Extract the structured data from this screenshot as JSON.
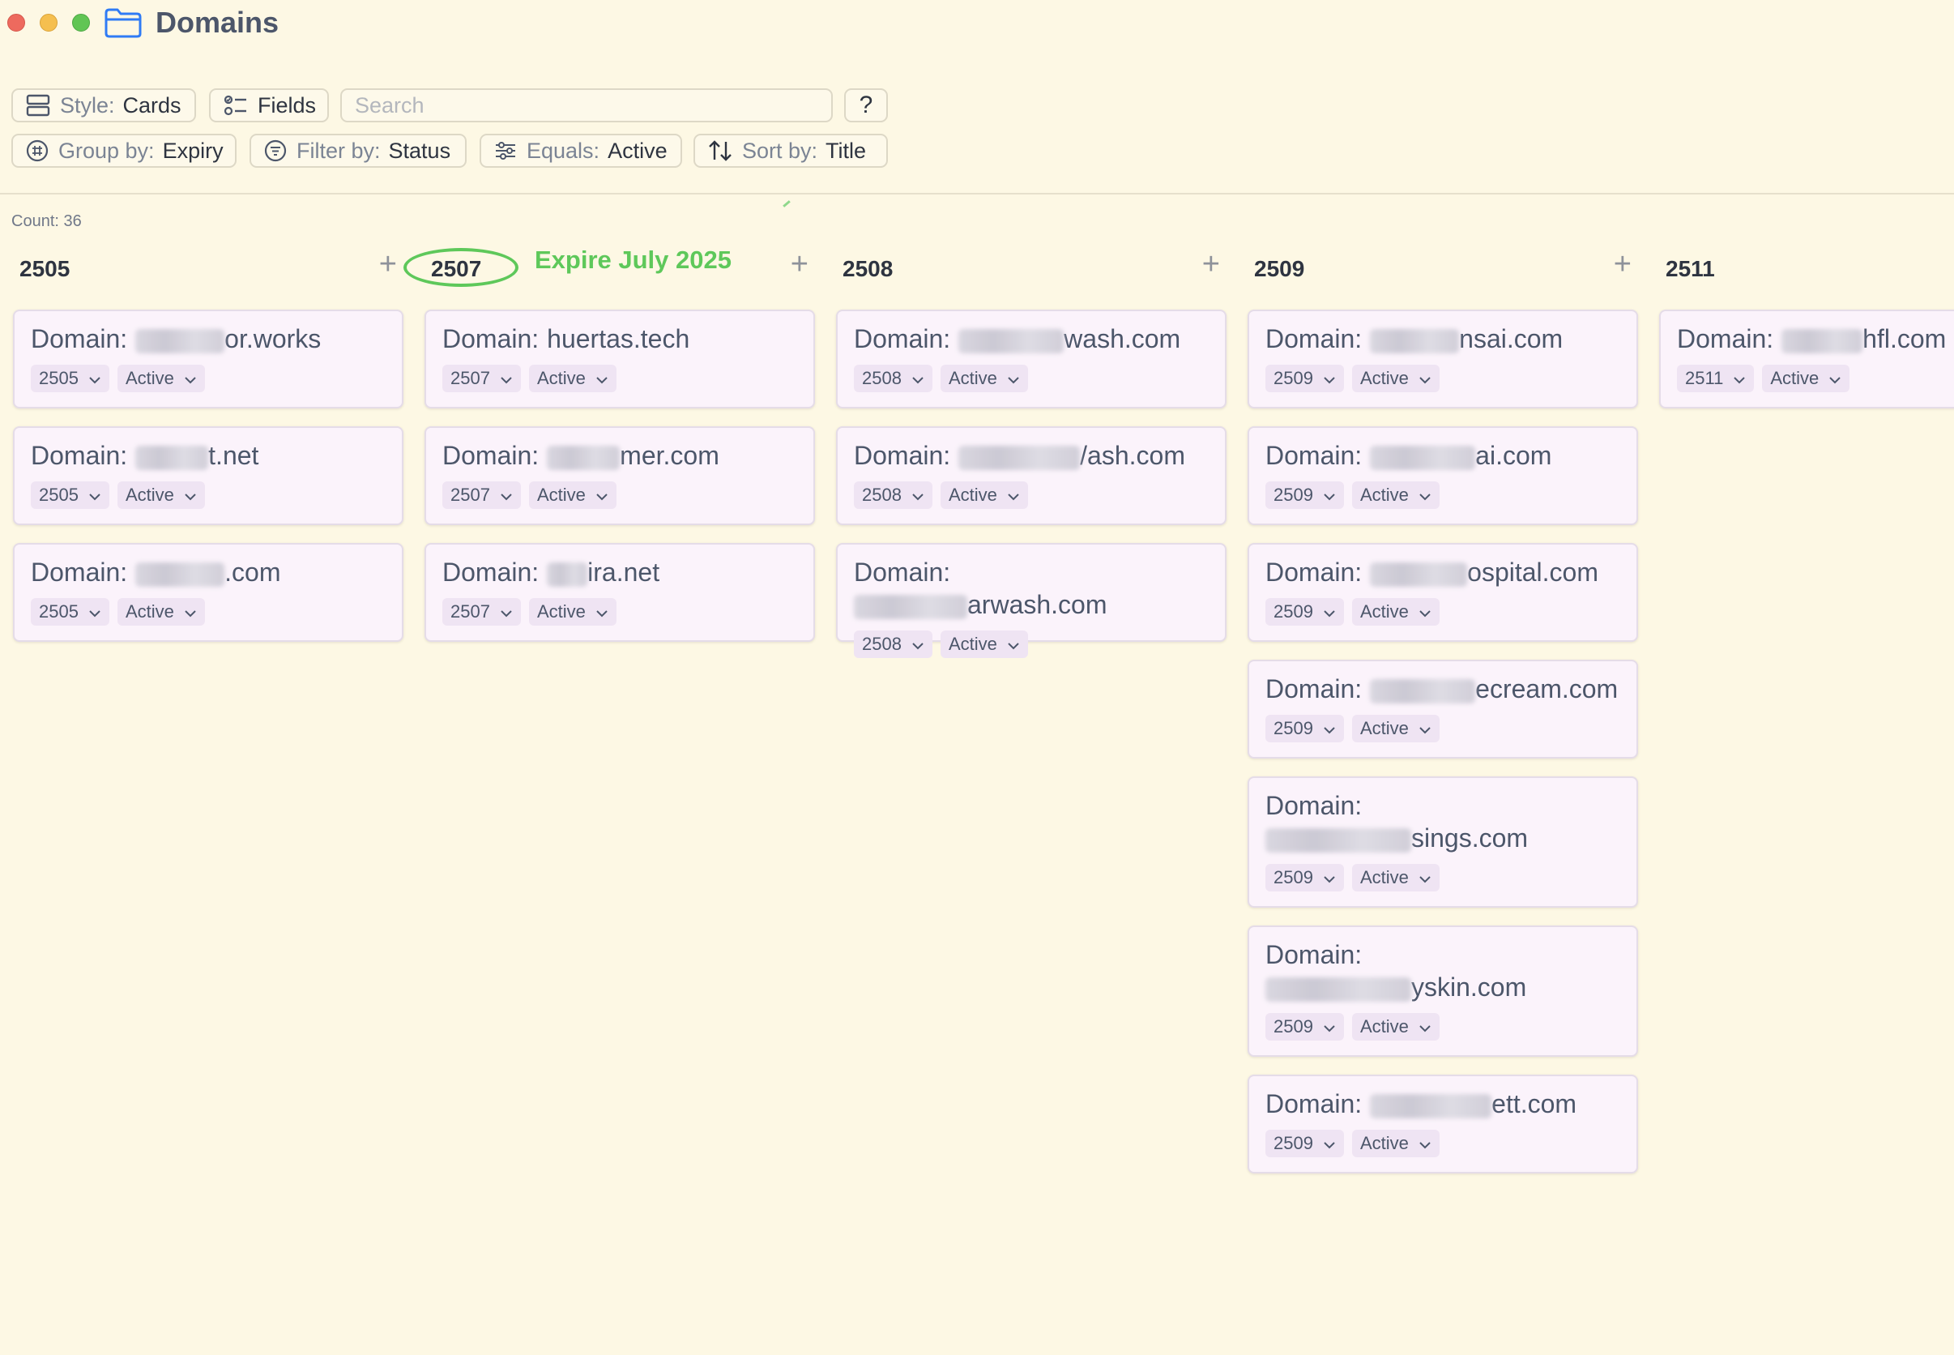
{
  "window": {
    "title": "Domains"
  },
  "toolbar": {
    "style": {
      "label": "Style:",
      "value": "Cards"
    },
    "fields": {
      "label": "Fields"
    },
    "search": {
      "placeholder": "Search",
      "value": ""
    },
    "help": {
      "label": "?"
    },
    "group_by": {
      "label": "Group by:",
      "value": "Expiry"
    },
    "filter_by": {
      "label": "Filter by:",
      "value": "Status"
    },
    "equals": {
      "label": "Equals:",
      "value": "Active"
    },
    "sort_by": {
      "label": "Sort by:",
      "value": "Title"
    }
  },
  "count_text": "Count: 36",
  "annotation": {
    "text": "Expire July 2025",
    "color": "#5ec85a"
  },
  "colors": {
    "background": "#fdf8e4",
    "card": "#fbf3fb",
    "pill": "#efe4f3",
    "annotation": "#5ec85a"
  },
  "card_prefix": "Domain:",
  "columns": [
    {
      "title": "2505",
      "add": "+",
      "cards": [
        {
          "domain_suffix": "or.works",
          "expiry": "2505",
          "status": "Active"
        },
        {
          "domain_suffix": "t.net",
          "expiry": "2505",
          "status": "Active"
        },
        {
          "domain_suffix": ".com",
          "expiry": "2505",
          "status": "Active"
        }
      ]
    },
    {
      "title": "2507",
      "add": "+",
      "cards": [
        {
          "domain_suffix": "huertas.tech",
          "expiry": "2507",
          "status": "Active"
        },
        {
          "domain_suffix": "mer.com",
          "expiry": "2507",
          "status": "Active"
        },
        {
          "domain_suffix": "ira.net",
          "expiry": "2507",
          "status": "Active"
        }
      ]
    },
    {
      "title": "2508",
      "add": "+",
      "cards": [
        {
          "domain_suffix": "wash.com",
          "expiry": "2508",
          "status": "Active"
        },
        {
          "domain_suffix": "/ash.com",
          "expiry": "2508",
          "status": "Active"
        },
        {
          "domain_suffix": "arwash.com",
          "expiry": "2508",
          "status": "Active"
        }
      ]
    },
    {
      "title": "2509",
      "add": "+",
      "cards": [
        {
          "domain_suffix": "nsai.com",
          "expiry": "2509",
          "status": "Active"
        },
        {
          "domain_suffix": "ai.com",
          "expiry": "2509",
          "status": "Active"
        },
        {
          "domain_suffix": "ospital.com",
          "expiry": "2509",
          "status": "Active"
        },
        {
          "domain_suffix": "ecream.com",
          "expiry": "2509",
          "status": "Active"
        },
        {
          "domain_suffix": "sings.com",
          "expiry": "2509",
          "status": "Active"
        },
        {
          "domain_suffix": "yskin.com",
          "expiry": "2509",
          "status": "Active"
        },
        {
          "domain_suffix": "ett.com",
          "expiry": "2509",
          "status": "Active"
        }
      ]
    },
    {
      "title": "2511",
      "add": "",
      "cards": [
        {
          "domain_suffix": "hfl.com",
          "expiry": "2511",
          "status": "Active"
        }
      ]
    }
  ]
}
